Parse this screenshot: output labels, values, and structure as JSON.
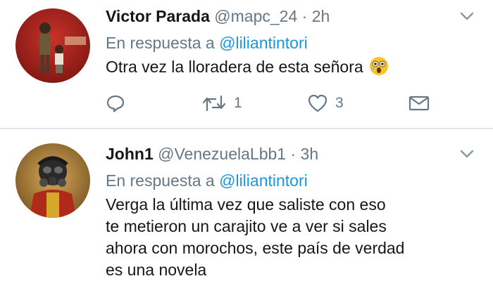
{
  "tweets": [
    {
      "name": "Victor Parada",
      "handle": "@mapc_24",
      "separator": "·",
      "time": "2h",
      "reply_prefix": "En respuesta a",
      "reply_to": "@liliantintori",
      "text": "Otra vez la lloradera de esta señora",
      "emoji": "astonished-face-icon",
      "retweets": "1",
      "likes": "3"
    },
    {
      "name": "John1",
      "handle": "@VenezuelaLbb1",
      "separator": "·",
      "time": "3h",
      "reply_prefix": "En respuesta a",
      "reply_to": "@liliantintori",
      "text": "Verga  la última vez que saliste con eso\nte metieron un carajito ve a ver si sales\nahora con morochos, este país de verdad\nes una novela"
    }
  ],
  "colors": {
    "name": "#14171a",
    "secondary": "#657786",
    "mention": "#1b95e0",
    "divider": "#e1e8ed"
  }
}
